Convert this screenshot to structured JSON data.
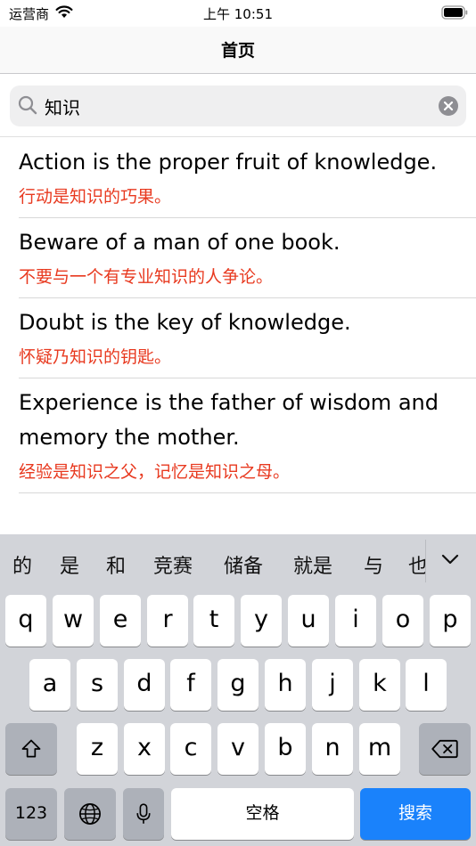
{
  "status_bar": {
    "carrier": "运营商",
    "time": "上午 10:51"
  },
  "nav": {
    "title": "首页"
  },
  "search": {
    "value": "知识"
  },
  "results": [
    {
      "en": "Action is the proper fruit of knowledge.",
      "cn": "行动是知识的巧果。"
    },
    {
      "en": "Beware of a man of one book.",
      "cn": "不要与一个有专业知识的人争论。"
    },
    {
      "en": "Doubt is the key of knowledge.",
      "cn": "怀疑乃知识的钥匙。"
    },
    {
      "en": "Experience is the father of wisdom and memory the mother.",
      "cn": "经验是知识之父，记忆是知识之母。"
    }
  ],
  "keyboard": {
    "suggestions": [
      "的",
      "是",
      "和",
      "竞赛",
      "储备",
      "就是",
      "与",
      "也"
    ],
    "row1": [
      "q",
      "w",
      "e",
      "r",
      "t",
      "y",
      "u",
      "i",
      "o",
      "p"
    ],
    "row2": [
      "a",
      "s",
      "d",
      "f",
      "g",
      "h",
      "j",
      "k",
      "l"
    ],
    "row3": [
      "z",
      "x",
      "c",
      "v",
      "b",
      "n",
      "m"
    ],
    "numbers_label": "123",
    "space_label": "空格",
    "search_label": "搜索"
  }
}
